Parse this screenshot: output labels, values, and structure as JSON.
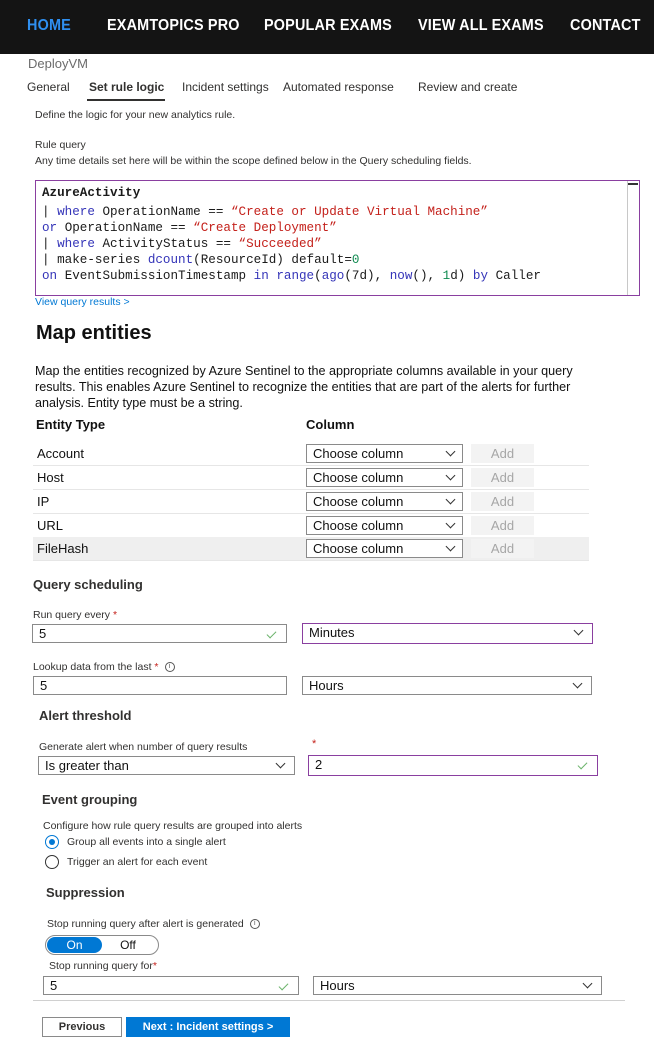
{
  "nav": {
    "items": [
      "HOME",
      "EXAMTOPICS PRO",
      "POPULAR EXAMS",
      "VIEW ALL EXAMS",
      "CONTACT"
    ]
  },
  "header": {
    "subtitle": "DeployVM"
  },
  "tabs": [
    "General",
    "Set rule logic",
    "Incident settings",
    "Automated response",
    "Review and create"
  ],
  "intro": "Define the logic for your new analytics rule.",
  "rule_query": {
    "label": "Rule query",
    "help": "Any time details set here will be within the scope defined below in the Query scheduling fields.",
    "line1": "AzureActivity",
    "l2_pipe": "|",
    "l2_kw": "where",
    "l2_mid": "OperationName ==",
    "l2_str": "“Create or Update Virtual Machine”",
    "l3_kw": "or",
    "l3_mid": "OperationName ==",
    "l3_str": "“Create Deployment”",
    "l4_pipe": "|",
    "l4_kw": "where",
    "l4_mid": "ActivityStatus ==",
    "l4_str": "“Succeeded”",
    "l5_pipe": "| make-series",
    "l5_kw": "dcount",
    "l5_mid": "(ResourceId) default=",
    "l5_num": "0",
    "l6_kw1": "on",
    "l6_mid1": "EventSubmissionTimestamp",
    "l6_kw2": "in",
    "l6_kw3": "range",
    "l6_p1": "(",
    "l6_kw4": "ago",
    "l6_p2": "(7d),",
    "l6_kw5": "now",
    "l6_p3": "(),",
    "l6_num": "1",
    "l6_p4": "d)",
    "l6_kw6": "by",
    "l6_mid2": "Caller",
    "view_results": "View query results >"
  },
  "map_entities": {
    "title": "Map entities",
    "desc_line1": "Map the entities recognized by Azure Sentinel to the appropriate columns available in your query",
    "desc_line2": "results. This enables Azure Sentinel to recognize the entities that are part of the alerts for further",
    "desc_line3": "analysis. Entity type must be a string.",
    "col_entity_type": "Entity Type",
    "col_column": "Column",
    "rows": [
      {
        "type": "Account",
        "select": "Choose column",
        "add": "Add"
      },
      {
        "type": "Host",
        "select": "Choose column",
        "add": "Add"
      },
      {
        "type": "IP",
        "select": "Choose column",
        "add": "Add"
      },
      {
        "type": "URL",
        "select": "Choose column",
        "add": "Add"
      },
      {
        "type": "FileHash",
        "select": "Choose column",
        "add": "Add"
      }
    ]
  },
  "scheduling": {
    "title": "Query scheduling",
    "run_label": "Run query every",
    "required": "*",
    "run_value": "5",
    "run_unit": "Minutes",
    "lookup_label": "Lookup data from the last",
    "lookup_value": "5",
    "lookup_unit": "Hours"
  },
  "alert_threshold": {
    "title": "Alert threshold",
    "label": "Generate alert when number of query results",
    "required": "*",
    "operator": "Is greater than",
    "value": "2"
  },
  "event_grouping": {
    "title": "Event grouping",
    "label": "Configure how rule query results are grouped into alerts",
    "option1": "Group all events into a single alert",
    "option2": "Trigger an alert for each event"
  },
  "suppression": {
    "title": "Suppression",
    "label": "Stop running query after alert is generated",
    "on": "On",
    "off": "Off",
    "stop_label": "Stop running query for",
    "required": "*",
    "stop_value": "5",
    "stop_unit": "Hours"
  },
  "footer": {
    "previous": "Previous",
    "next": "Next : Incident settings >"
  }
}
